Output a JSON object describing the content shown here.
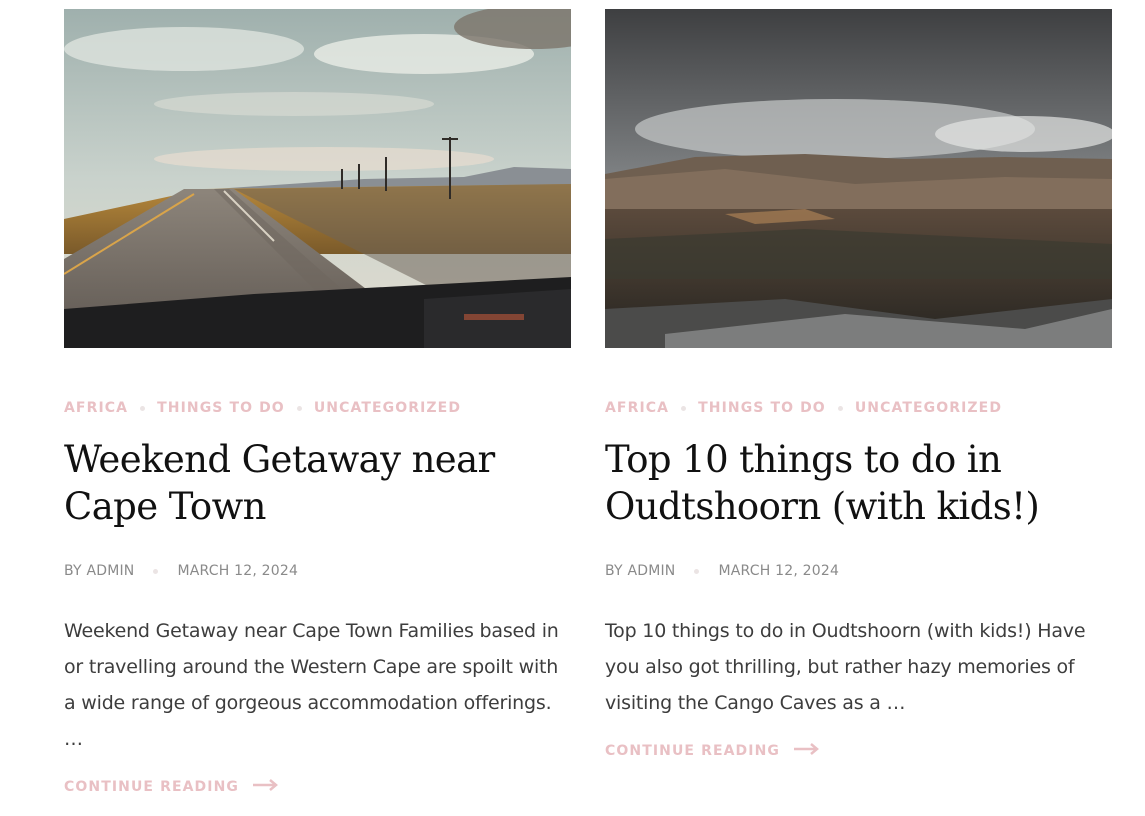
{
  "posts": [
    {
      "image_alt": "Road trip view through a car windshield on an open highway",
      "categories": [
        "AFRICA",
        "THINGS TO DO",
        "UNCATEGORIZED"
      ],
      "title": "Weekend Getaway near Cape Town",
      "author": "BY ADMIN",
      "date": "MARCH 12, 2024",
      "excerpt": "Weekend Getaway near Cape Town   Families based in or travelling around the Western Cape are spoilt with a wide range of gorgeous accommodation offerings. …",
      "read_more": "CONTINUE READING",
      "read_more_icon": "arrow-right-icon"
    },
    {
      "image_alt": "Mountain valley under heavy clouds",
      "categories": [
        "AFRICA",
        "THINGS TO DO",
        "UNCATEGORIZED"
      ],
      "title": "Top 10 things to do in Oudtshoorn (with kids!)",
      "author": "BY ADMIN",
      "date": "MARCH 12, 2024",
      "excerpt": "Top 10 things to do in Oudtshoorn (with kids!) Have you also got thrilling, but rather hazy memories of visiting the Cango Caves as a …",
      "read_more": "CONTINUE READING",
      "read_more_icon": "arrow-right-icon"
    }
  ],
  "colors": {
    "accent": "#e9c0c4",
    "title": "#111111",
    "meta": "#8a8a8a",
    "body": "#3d3d3d"
  }
}
